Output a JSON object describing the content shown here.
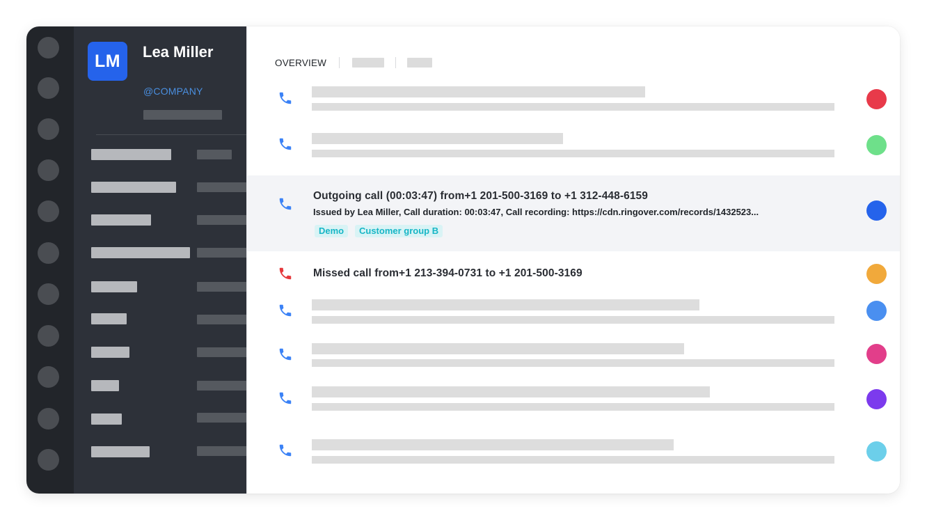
{
  "user": {
    "initials": "LM",
    "name": "Lea Miller",
    "company": "@COMPANY"
  },
  "tabs": {
    "active_label": "OVERVIEW"
  },
  "icons": {
    "phone": "phone-icon",
    "missed": "phone-missed-icon"
  },
  "colors": {
    "accent": "#2563eb",
    "phone_blue": "#3b82f6",
    "phone_red": "#e5383b",
    "tag_text": "#17b6c6",
    "tag_bg": "#d9f3f5"
  },
  "calls": {
    "highlighted": {
      "title": "Outgoing call (00:03:47) from+1 201-500-3169 to +1 312-448-6159",
      "subtitle": "Issued by Lea Miller, Call duration: 00:03:47, Call recording: https://cdn.ringover.com/records/1432523...",
      "tags": [
        "Demo",
        "Customer group B"
      ],
      "status_color": "#2563eb"
    },
    "missed": {
      "title": "Missed call from+1 213-394-0731 to +1 201-500-3169",
      "status_color": "#f1a93b"
    },
    "placeholder_status_colors": [
      "#e83a4a",
      "#6ee08a",
      "#4a8ff0",
      "#e23e8a",
      "#7c3aed",
      "#6ccfea"
    ]
  }
}
